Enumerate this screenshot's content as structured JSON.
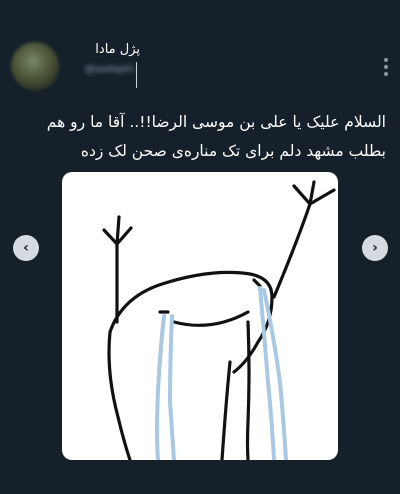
{
  "tweet": {
    "author_name": "پژل مادا",
    "author_handle": "@sadaphi",
    "text_lines": [
      "السلام علیک یا علی بن موسی الرضا!!.. آقا ما رو هم",
      "بطلب مشهد دلم برای تک مناره‌ی صحن لک زده"
    ]
  },
  "media": {
    "image_alt": "stick figure crying with arms raised",
    "colors": {
      "tears": "#a9c8e4",
      "ink": "#111111",
      "background": "#ffffff"
    }
  },
  "carousel": {
    "prev_glyph": "‹",
    "next_glyph": "›"
  },
  "menu": {
    "more_glyph": "⋮"
  },
  "theme": {
    "background": "#15202b",
    "secondary_text": "#8b98a5"
  }
}
